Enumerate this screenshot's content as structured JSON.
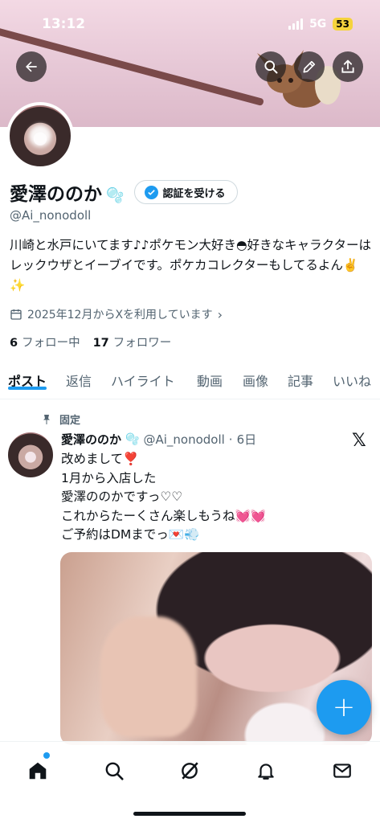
{
  "status_bar": {
    "time": "13:12",
    "network": "5G",
    "battery": "53"
  },
  "header": {
    "back_icon": "arrow-left-icon",
    "search_icon": "search-icon",
    "edit_icon": "pencil-icon",
    "share_icon": "share-icon"
  },
  "profile": {
    "display_name": "愛澤ののか",
    "name_emoji": "🫧",
    "verify_label": "認証を受ける",
    "handle": "@Ai_nonodoll",
    "bio": "川崎と水戸にいてます♪♪ポケモン大好き◓好きなキャラクターはレックウザとイーブイです。ポケカコレクターもしてるよん✌️ ✨",
    "joined": "2025年12月からXを利用しています",
    "following_count": "6",
    "following_label": "フォロー中",
    "followers_count": "17",
    "followers_label": "フォロワー"
  },
  "tabs": [
    {
      "label": "ポスト",
      "active": true
    },
    {
      "label": "返信",
      "active": false
    },
    {
      "label": "ハイライト",
      "active": false
    },
    {
      "label": "動画",
      "active": false
    },
    {
      "label": "画像",
      "active": false
    },
    {
      "label": "記事",
      "active": false
    },
    {
      "label": "いいね",
      "active": false
    }
  ],
  "pinned_post": {
    "pinned_label": "固定",
    "author_name": "愛澤ののか",
    "author_emoji": "🫧",
    "author_handle": "@Ai_nonodoll",
    "separator": "·",
    "time": "6日",
    "lines": [
      "改めまして❣️",
      "1月から入店した",
      "愛澤ののかですっ♡♡",
      "これからたーくさん楽しもうね💓💓",
      "ご予約はDMまでっ💌💨"
    ]
  },
  "colors": {
    "accent": "#1d9bf0",
    "text": "#0f1419",
    "secondary": "#536471"
  },
  "bottom_nav": [
    "home-icon",
    "search-icon",
    "grok-icon",
    "bell-icon",
    "mail-icon"
  ]
}
